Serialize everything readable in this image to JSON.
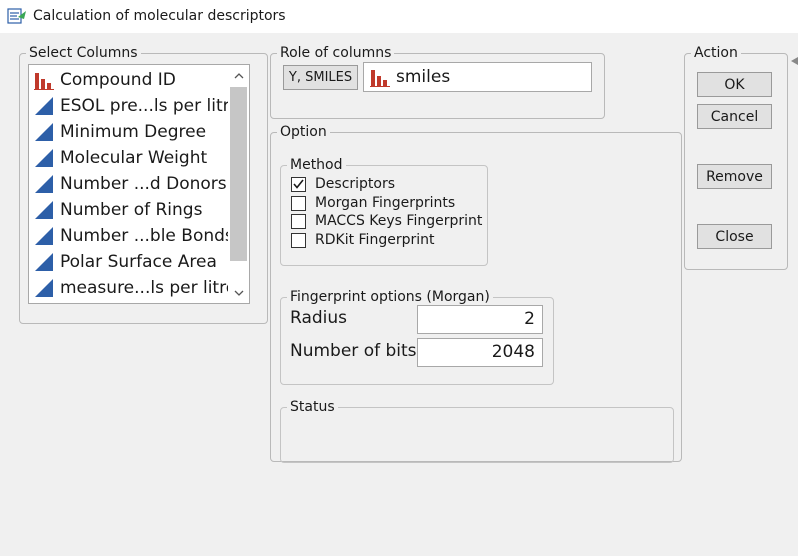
{
  "window": {
    "title": "Calculation of molecular descriptors",
    "icon": "descriptor-app-icon"
  },
  "select_columns": {
    "legend": "Select Columns",
    "items": [
      {
        "label": "Compound ID",
        "icon": "nominal-column-icon"
      },
      {
        "label": "ESOL pre...ls per litre",
        "icon": "continuous-column-icon"
      },
      {
        "label": "Minimum Degree",
        "icon": "continuous-column-icon"
      },
      {
        "label": "Molecular Weight",
        "icon": "continuous-column-icon"
      },
      {
        "label": "Number ...d Donors",
        "icon": "continuous-column-icon"
      },
      {
        "label": "Number of Rings",
        "icon": "continuous-column-icon"
      },
      {
        "label": "Number ...ble Bonds",
        "icon": "continuous-column-icon"
      },
      {
        "label": "Polar Surface Area",
        "icon": "continuous-column-icon"
      },
      {
        "label": "measure...ls per litre",
        "icon": "continuous-column-icon"
      }
    ]
  },
  "role_of_columns": {
    "legend": "Role of columns",
    "role_button": "Y, SMILES",
    "assigned_column": "smiles",
    "assigned_icon": "nominal-column-icon"
  },
  "option": {
    "legend": "Option",
    "method": {
      "legend": "Method",
      "options": [
        {
          "label": "Descriptors",
          "checked": true
        },
        {
          "label": "Morgan Fingerprints",
          "checked": false
        },
        {
          "label": "MACCS Keys Fingerprint",
          "checked": false
        },
        {
          "label": "RDKit Fingerprint",
          "checked": false
        }
      ]
    },
    "fingerprint": {
      "legend": "Fingerprint options (Morgan)",
      "radius_label": "Radius",
      "radius_value": "2",
      "bits_label": "Number of bits",
      "bits_value": "2048"
    },
    "status": {
      "legend": "Status",
      "text": ""
    }
  },
  "action": {
    "legend": "Action",
    "ok": "OK",
    "cancel": "Cancel",
    "remove": "Remove",
    "close": "Close"
  },
  "colors": {
    "nominal_icon": "#c0392b",
    "continuous_icon": "#2d5fa8"
  }
}
